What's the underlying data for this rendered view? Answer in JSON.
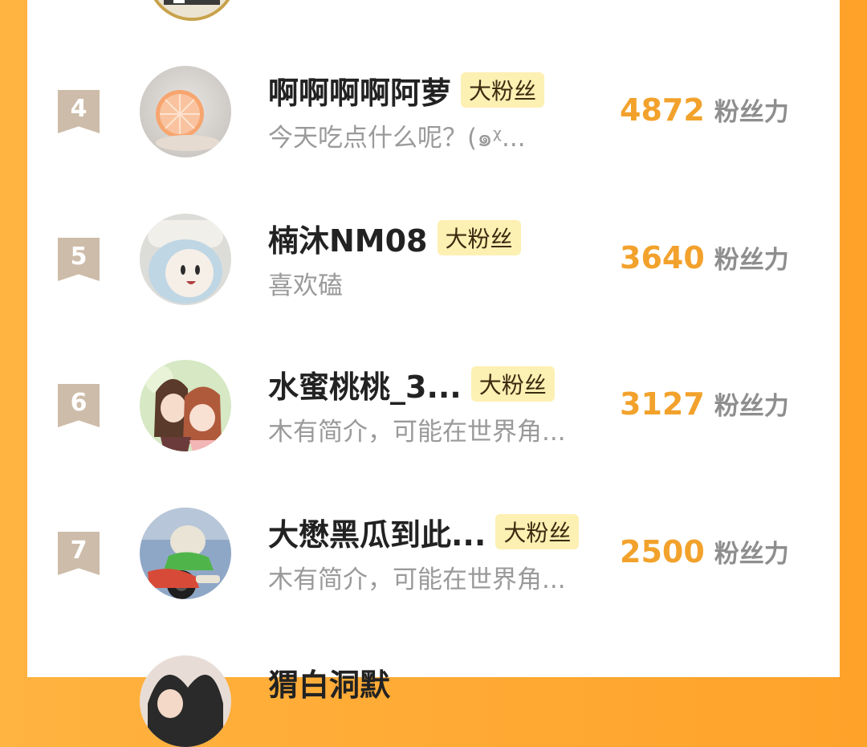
{
  "rows": [
    {
      "rank": "4",
      "name": "啊啊啊啊阿萝",
      "badge": "大粉丝",
      "bio": "今天吃点什么呢？(๑ᵡ...",
      "score": "4872",
      "score_label": "粉丝力",
      "avatar": "grapefruit-avatar"
    },
    {
      "rank": "5",
      "name": "楠沐NM08",
      "badge": "大粉丝",
      "bio": "喜欢磕",
      "score": "3640",
      "score_label": "粉丝力",
      "avatar": "blue-hair-doll-avatar"
    },
    {
      "rank": "6",
      "name": "水蜜桃桃_3...",
      "badge": "大粉丝",
      "bio": "木有简介，可能在世界角...",
      "score": "3127",
      "score_label": "粉丝力",
      "avatar": "anime-couple-avatar"
    },
    {
      "rank": "7",
      "name": "大懋黑瓜到此...",
      "badge": "大粉丝",
      "bio": "木有简介，可能在世界角...",
      "score": "2500",
      "score_label": "粉丝力",
      "avatar": "cartoon-rider-avatar"
    }
  ],
  "partial_next_name": "猬白洞默",
  "colors": {
    "accent": "#f2a22c",
    "badge_bg": "#fdf0b3",
    "rank_bg": "#cdbca9",
    "frame": "#ffa22a"
  }
}
